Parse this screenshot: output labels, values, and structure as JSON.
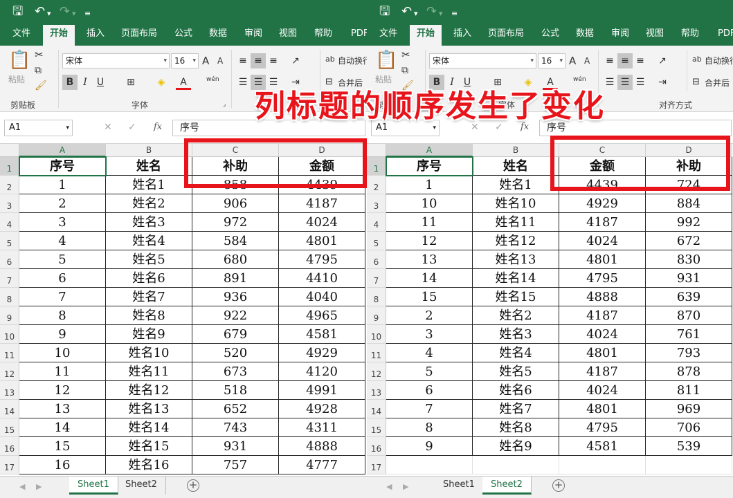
{
  "caption": "列标题的顺序发生了变化",
  "ribbon": {
    "tabs": [
      "文件",
      "开始",
      "插入",
      "页面布局",
      "公式",
      "数据",
      "审阅",
      "视图",
      "帮助",
      "PDF"
    ],
    "active_tab": "开始",
    "font_name": "宋体",
    "font_size": "16",
    "paste_label": "粘贴",
    "clipboard_label": "剪贴板",
    "font_group_label": "字体",
    "align_group_label": "对齐方式",
    "wrap_text": "自动换行",
    "merge_center": "合并后",
    "bold": "B",
    "italic": "I",
    "underline": "U",
    "grow_font": "A",
    "shrink_font": "A",
    "phonetic": "wén"
  },
  "windows": [
    {
      "name_box": "A1",
      "formula": "序号",
      "columns": [
        "A",
        "B",
        "C",
        "D"
      ],
      "headers": [
        "序号",
        "姓名",
        "补助",
        "金额"
      ],
      "rows": [
        [
          "1",
          "姓名1",
          "858",
          "4439"
        ],
        [
          "2",
          "姓名2",
          "906",
          "4187"
        ],
        [
          "3",
          "姓名3",
          "972",
          "4024"
        ],
        [
          "4",
          "姓名4",
          "584",
          "4801"
        ],
        [
          "5",
          "姓名5",
          "680",
          "4795"
        ],
        [
          "6",
          "姓名6",
          "891",
          "4410"
        ],
        [
          "7",
          "姓名7",
          "936",
          "4040"
        ],
        [
          "8",
          "姓名8",
          "922",
          "4965"
        ],
        [
          "9",
          "姓名9",
          "679",
          "4581"
        ],
        [
          "10",
          "姓名10",
          "520",
          "4929"
        ],
        [
          "11",
          "姓名11",
          "673",
          "4120"
        ],
        [
          "12",
          "姓名12",
          "518",
          "4991"
        ],
        [
          "13",
          "姓名13",
          "652",
          "4928"
        ],
        [
          "14",
          "姓名14",
          "743",
          "4311"
        ],
        [
          "15",
          "姓名15",
          "931",
          "4888"
        ],
        [
          "16",
          "姓名16",
          "757",
          "4777"
        ]
      ],
      "row_numbers": [
        "1",
        "2",
        "3",
        "4",
        "5",
        "6",
        "7",
        "8",
        "9",
        "10",
        "11",
        "12",
        "13",
        "14",
        "15",
        "16",
        "17"
      ],
      "sheets": [
        "Sheet1",
        "Sheet2"
      ],
      "active_sheet": "Sheet1"
    },
    {
      "name_box": "A1",
      "formula": "序号",
      "columns": [
        "A",
        "B",
        "C",
        "D"
      ],
      "headers": [
        "序号",
        "姓名",
        "金额",
        "补助"
      ],
      "rows": [
        [
          "1",
          "姓名1",
          "4439",
          "724"
        ],
        [
          "10",
          "姓名10",
          "4929",
          "884"
        ],
        [
          "11",
          "姓名11",
          "4187",
          "992"
        ],
        [
          "12",
          "姓名12",
          "4024",
          "672"
        ],
        [
          "13",
          "姓名13",
          "4801",
          "830"
        ],
        [
          "14",
          "姓名14",
          "4795",
          "931"
        ],
        [
          "15",
          "姓名15",
          "4888",
          "639"
        ],
        [
          "2",
          "姓名2",
          "4187",
          "870"
        ],
        [
          "3",
          "姓名3",
          "4024",
          "761"
        ],
        [
          "4",
          "姓名4",
          "4801",
          "793"
        ],
        [
          "5",
          "姓名5",
          "4187",
          "878"
        ],
        [
          "6",
          "姓名6",
          "4024",
          "811"
        ],
        [
          "7",
          "姓名7",
          "4801",
          "969"
        ],
        [
          "8",
          "姓名8",
          "4795",
          "706"
        ],
        [
          "9",
          "姓名9",
          "4581",
          "539"
        ]
      ],
      "row_numbers": [
        "1",
        "2",
        "3",
        "4",
        "5",
        "6",
        "7",
        "8",
        "9",
        "10",
        "11",
        "12",
        "13",
        "14",
        "15",
        "16",
        "17"
      ],
      "sheets": [
        "Sheet1",
        "Sheet2"
      ],
      "active_sheet": "Sheet2"
    }
  ]
}
